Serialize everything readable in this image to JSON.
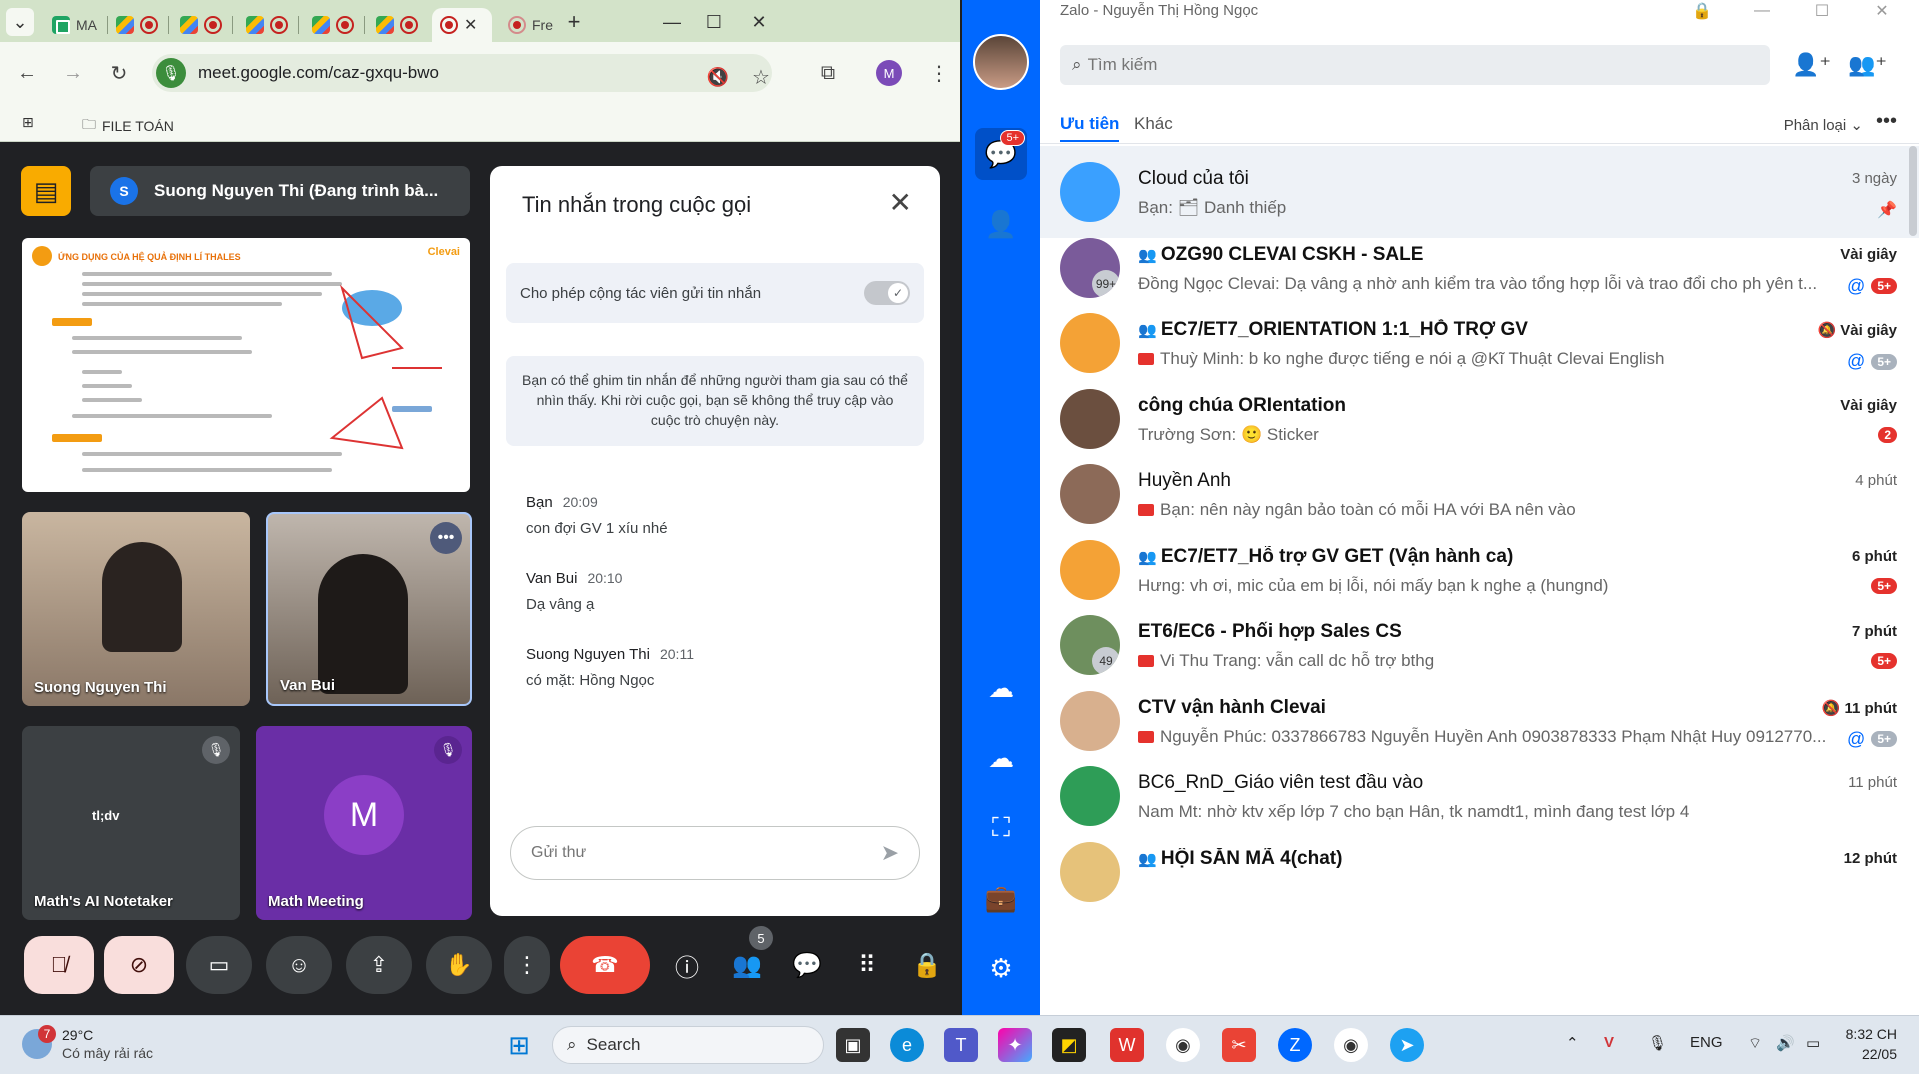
{
  "chrome": {
    "tabs": [
      {
        "label": "MA",
        "kind": "sheet"
      },
      {
        "label": "",
        "kind": "meet"
      },
      {
        "label": "",
        "kind": "meet"
      },
      {
        "label": "",
        "kind": "meet"
      },
      {
        "label": "",
        "kind": "meet"
      },
      {
        "label": "",
        "kind": "meet"
      },
      {
        "label": "",
        "kind": "meet-active"
      },
      {
        "label": "Fre",
        "kind": "other"
      }
    ],
    "url": "meet.google.com/caz-gxqu-bwo",
    "profile_initial": "M",
    "bookmark_folder": "FILE TOÁN"
  },
  "meet": {
    "presenter_initial": "S",
    "presenter_label": "Suong Nguyen Thi (Đang trình bà...",
    "slide": {
      "title": "ỨNG DỤNG CỦA HỆ QUẢ ĐỊNH LÍ THALES",
      "brand": "Clevai"
    },
    "tiles": [
      {
        "name": "Suong Nguyen Thi"
      },
      {
        "name": "Van Bui"
      },
      {
        "name": "Math's AI Notetaker"
      },
      {
        "name": "Math Meeting",
        "initial": "M"
      }
    ],
    "notetaker_logo": "tl;dv",
    "chat": {
      "title": "Tin nhắn trong cuộc gọi",
      "toggle_label": "Cho phép cộng tác viên gửi tin nhắn",
      "info": "Bạn có thể ghim tin nhắn để những người tham gia sau có thể nhìn thấy. Khi rời cuộc gọi, bạn sẽ không thể truy cập vào cuộc trò chuyện này.",
      "messages": [
        {
          "sender": "Bạn",
          "time": "20:09",
          "text": "con đợi GV 1 xíu nhé"
        },
        {
          "sender": "Van Bui",
          "time": "20:10",
          "text": "Dạ vâng ạ"
        },
        {
          "sender": "Suong Nguyen Thi",
          "time": "20:11",
          "text": "có mặt: Hồng Ngọc"
        }
      ],
      "input_placeholder": "Gửi thư"
    },
    "participants_count": "5"
  },
  "zalo": {
    "title": "Zalo - Nguyễn Thị Hồng Ngọc",
    "search_placeholder": "Tìm kiếm",
    "chat_badge": "5+",
    "tabs": [
      "Ưu tiên",
      "Khác"
    ],
    "sort_label": "Phân loại",
    "conversations": [
      {
        "name": "Cloud của tôi",
        "msg": "Bạn: 🗂 Danh thiếp",
        "time": "3 ngày",
        "bold": false,
        "group": false,
        "pinned": true
      },
      {
        "name": "OZG90 CLEVAI CSKH - SALE",
        "msg": "Đồng Ngọc Clevai: Dạ vâng ạ nhờ anh kiểm tra vào tổng hợp lỗi và trao đổi cho ph yên t...",
        "time": "Vài giây",
        "bold": true,
        "group": true,
        "badge": "5+",
        "badge_red": true,
        "at": true,
        "avatar_count": "99+"
      },
      {
        "name": "EC7/ET7_ORIENTATION 1:1_HỖ TRỢ GV",
        "msg": "Thuỳ Minh: b ko nghe được tiếng e nói ạ @Kĩ Thuật Clevai English",
        "time": "Vài giây",
        "bold": true,
        "group": true,
        "badge": "5+",
        "badge_red": false,
        "at": true,
        "muted": true,
        "video": true
      },
      {
        "name": "công chúa ORIentation",
        "msg": "Trường Sơn: 🙂 Sticker",
        "time": "Vài giây",
        "bold": true,
        "group": false,
        "badge": "2",
        "badge_red": true
      },
      {
        "name": "Huyền Anh",
        "msg": "Bạn: nên này ngân bảo toàn có mỗi HA với BA nên vào",
        "time": "4 phút",
        "bold": false,
        "group": false,
        "video": true
      },
      {
        "name": "EC7/ET7_Hỗ trợ GV GET (Vận hành ca)",
        "msg": "Hưng: vh ơi, mic của em bị lỗi, nói mấy bạn k nghe ạ (hungnd)",
        "time": "6 phút",
        "bold": true,
        "group": true,
        "badge": "5+",
        "badge_red": true
      },
      {
        "name": "ET6/EC6 - Phối hợp Sales  CS",
        "msg": "Vi Thu Trang: vẫn call dc hỗ trợ bthg",
        "time": "7 phút",
        "bold": true,
        "group": false,
        "badge": "5+",
        "badge_red": true,
        "video": true,
        "avatar_count": "49"
      },
      {
        "name": "CTV vận hành Clevai",
        "msg": "Nguyễn Phúc: 0337866783 Nguyễn Huyền Anh 0903878333 Phạm Nhật Huy 0912770...",
        "time": "11 phút",
        "bold": true,
        "group": false,
        "badge": "5+",
        "badge_red": false,
        "at": true,
        "muted": true,
        "video": true
      },
      {
        "name": "BC6_RnD_Giáo viên test đầu vào",
        "msg": "Nam Mt: nhờ ktv xếp lớp 7 cho bạn Hân, tk namdt1, mình đang test lớp 4",
        "time": "11 phút",
        "bold": false,
        "group": false
      },
      {
        "name": "HỘI SĂN MÃ 4(chat)",
        "msg": "",
        "time": "12 phút",
        "bold": true,
        "group": true
      }
    ]
  },
  "taskbar": {
    "weather_temp": "29°C",
    "weather_desc": "Có mây rải rác",
    "weather_badge": "7",
    "search_label": "Search",
    "language": "ENG",
    "time": "8:32 CH",
    "date": "22/05"
  }
}
